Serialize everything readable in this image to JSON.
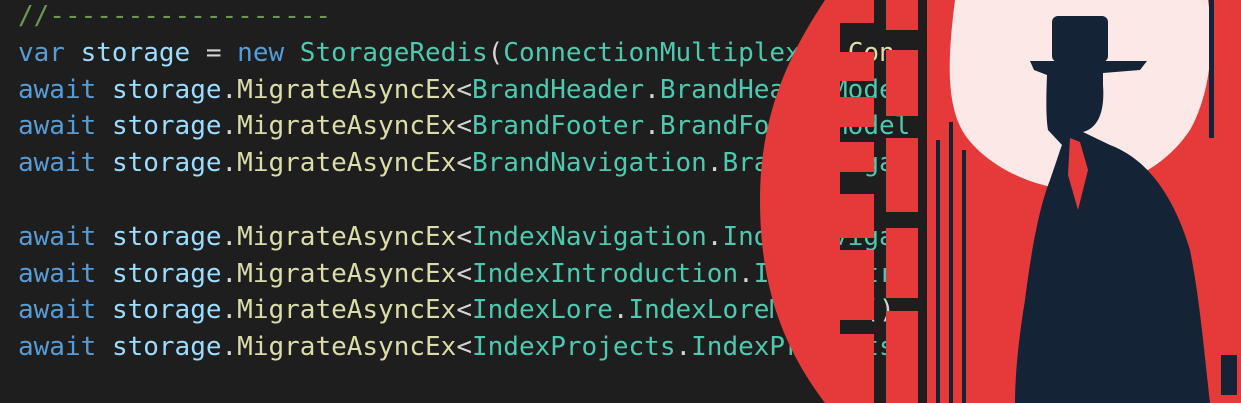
{
  "editor": {
    "lines": [
      {
        "tokens": [
          {
            "text": "//------------------",
            "kind": "comment"
          }
        ]
      },
      {
        "tokens": [
          {
            "text": "var",
            "kind": "keyword"
          },
          {
            "text": " ",
            "kind": "plain"
          },
          {
            "text": "storage",
            "kind": "variable"
          },
          {
            "text": " = ",
            "kind": "plain"
          },
          {
            "text": "new",
            "kind": "keyword"
          },
          {
            "text": " ",
            "kind": "plain"
          },
          {
            "text": "StorageRedis",
            "kind": "type"
          },
          {
            "text": "(",
            "kind": "punct"
          },
          {
            "text": "ConnectionMultiplexer",
            "kind": "type"
          },
          {
            "text": ".",
            "kind": "punct"
          },
          {
            "text": "Con",
            "kind": "method"
          }
        ]
      },
      {
        "tokens": [
          {
            "text": "await",
            "kind": "keyword"
          },
          {
            "text": " ",
            "kind": "plain"
          },
          {
            "text": "storage",
            "kind": "variable"
          },
          {
            "text": ".",
            "kind": "punct"
          },
          {
            "text": "MigrateAsyncEx",
            "kind": "method"
          },
          {
            "text": "<",
            "kind": "punct"
          },
          {
            "text": "BrandHeader",
            "kind": "type"
          },
          {
            "text": ".",
            "kind": "punct"
          },
          {
            "text": "BrandHeaderModel",
            "kind": "type"
          }
        ]
      },
      {
        "tokens": [
          {
            "text": "await",
            "kind": "keyword"
          },
          {
            "text": " ",
            "kind": "plain"
          },
          {
            "text": "storage",
            "kind": "variable"
          },
          {
            "text": ".",
            "kind": "punct"
          },
          {
            "text": "MigrateAsyncEx",
            "kind": "method"
          },
          {
            "text": "<",
            "kind": "punct"
          },
          {
            "text": "BrandFooter",
            "kind": "type"
          },
          {
            "text": ".",
            "kind": "punct"
          },
          {
            "text": "BrandFooterModel",
            "kind": "type"
          }
        ]
      },
      {
        "tokens": [
          {
            "text": "await",
            "kind": "keyword"
          },
          {
            "text": " ",
            "kind": "plain"
          },
          {
            "text": "storage",
            "kind": "variable"
          },
          {
            "text": ".",
            "kind": "punct"
          },
          {
            "text": "MigrateAsyncEx",
            "kind": "method"
          },
          {
            "text": "<",
            "kind": "punct"
          },
          {
            "text": "BrandNavigation",
            "kind": "type"
          },
          {
            "text": ".",
            "kind": "punct"
          },
          {
            "text": "BrandNaviga",
            "kind": "type"
          }
        ]
      },
      {
        "tokens": []
      },
      {
        "tokens": [
          {
            "text": "await",
            "kind": "keyword"
          },
          {
            "text": " ",
            "kind": "plain"
          },
          {
            "text": "storage",
            "kind": "variable"
          },
          {
            "text": ".",
            "kind": "punct"
          },
          {
            "text": "MigrateAsyncEx",
            "kind": "method"
          },
          {
            "text": "<",
            "kind": "punct"
          },
          {
            "text": "IndexNavigation",
            "kind": "type"
          },
          {
            "text": ".",
            "kind": "punct"
          },
          {
            "text": "IndexNaviga",
            "kind": "type"
          }
        ]
      },
      {
        "tokens": [
          {
            "text": "await",
            "kind": "keyword"
          },
          {
            "text": " ",
            "kind": "plain"
          },
          {
            "text": "storage",
            "kind": "variable"
          },
          {
            "text": ".",
            "kind": "punct"
          },
          {
            "text": "MigrateAsyncEx",
            "kind": "method"
          },
          {
            "text": "<",
            "kind": "punct"
          },
          {
            "text": "IndexIntroduction",
            "kind": "type"
          },
          {
            "text": ".",
            "kind": "punct"
          },
          {
            "text": "IndexIntr",
            "kind": "type"
          }
        ]
      },
      {
        "tokens": [
          {
            "text": "await",
            "kind": "keyword"
          },
          {
            "text": " ",
            "kind": "plain"
          },
          {
            "text": "storage",
            "kind": "variable"
          },
          {
            "text": ".",
            "kind": "punct"
          },
          {
            "text": "MigrateAsyncEx",
            "kind": "method"
          },
          {
            "text": "<",
            "kind": "punct"
          },
          {
            "text": "IndexLore",
            "kind": "type"
          },
          {
            "text": ".",
            "kind": "punct"
          },
          {
            "text": "IndexLoreModel",
            "kind": "type"
          },
          {
            "text": ">()",
            "kind": "punct"
          }
        ]
      },
      {
        "tokens": [
          {
            "text": "await",
            "kind": "keyword"
          },
          {
            "text": " ",
            "kind": "plain"
          },
          {
            "text": "storage",
            "kind": "variable"
          },
          {
            "text": ".",
            "kind": "punct"
          },
          {
            "text": "MigrateAsyncEx",
            "kind": "method"
          },
          {
            "text": "<",
            "kind": "punct"
          },
          {
            "text": "IndexProjects",
            "kind": "type"
          },
          {
            "text": ".",
            "kind": "punct"
          },
          {
            "text": "IndexProjects",
            "kind": "type"
          }
        ]
      }
    ]
  },
  "artwork": {
    "icon": "spy-silhouette-icon",
    "colors": {
      "editor_background": "#1e1e1e",
      "accent_red": "#e63a3a",
      "moon_pink": "#fde8e8",
      "silhouette_navy": "#142436"
    }
  }
}
